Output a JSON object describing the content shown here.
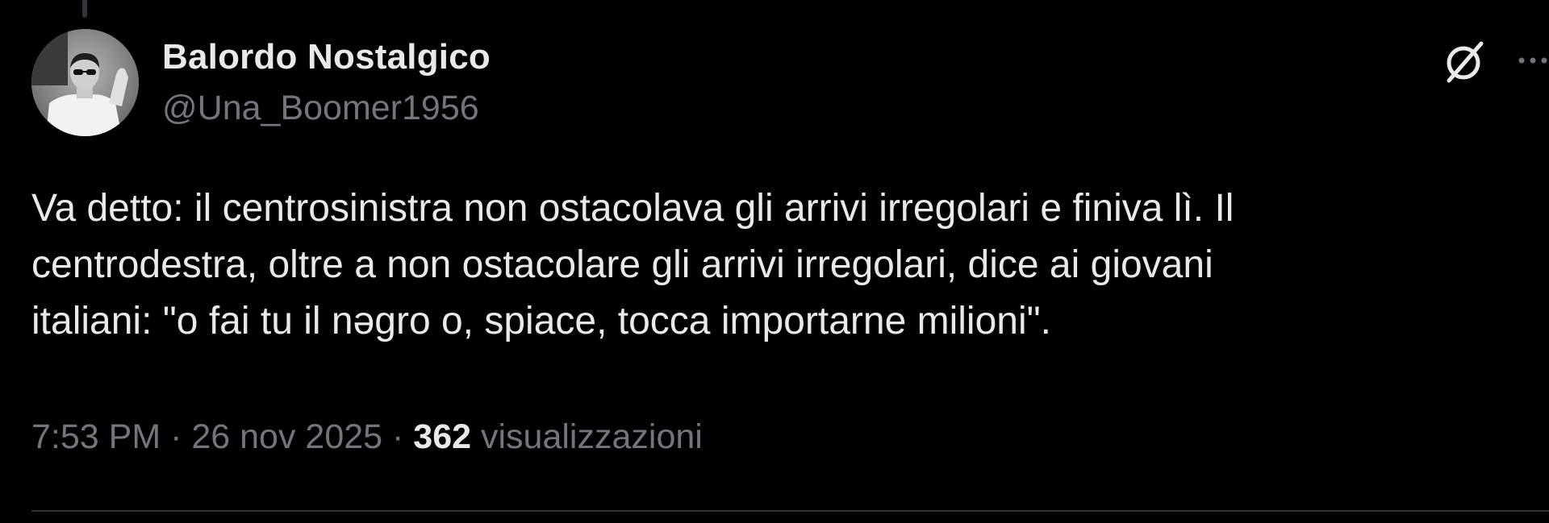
{
  "tweet": {
    "author": {
      "display_name": "Balordo Nostalgico",
      "handle": "@Una_Boomer1956",
      "avatar_icon": "avatar-photo-bw"
    },
    "text": "Va detto: il centrosinistra non ostacolava gli arrivi irregolari e finiva lì. Il\ncentrodestra, oltre a non ostacolare gli arrivi irregolari, dice ai giovani\nitaliani: \"o fai tu il nəgro o, spiace, tocca importarne milioni\".",
    "meta": {
      "time": "7:53 PM",
      "separator": " · ",
      "date": "26 nov 2025",
      "views_count": "362",
      "views_label": " visualizzazioni"
    },
    "actions": {
      "grok_icon": "grok-slash-circle-icon",
      "more_icon": "more-dots-icon"
    }
  },
  "colors": {
    "background": "#000000",
    "primary_text": "#e7e9ea",
    "secondary_text": "#71767b",
    "divider": "#2f3336"
  }
}
